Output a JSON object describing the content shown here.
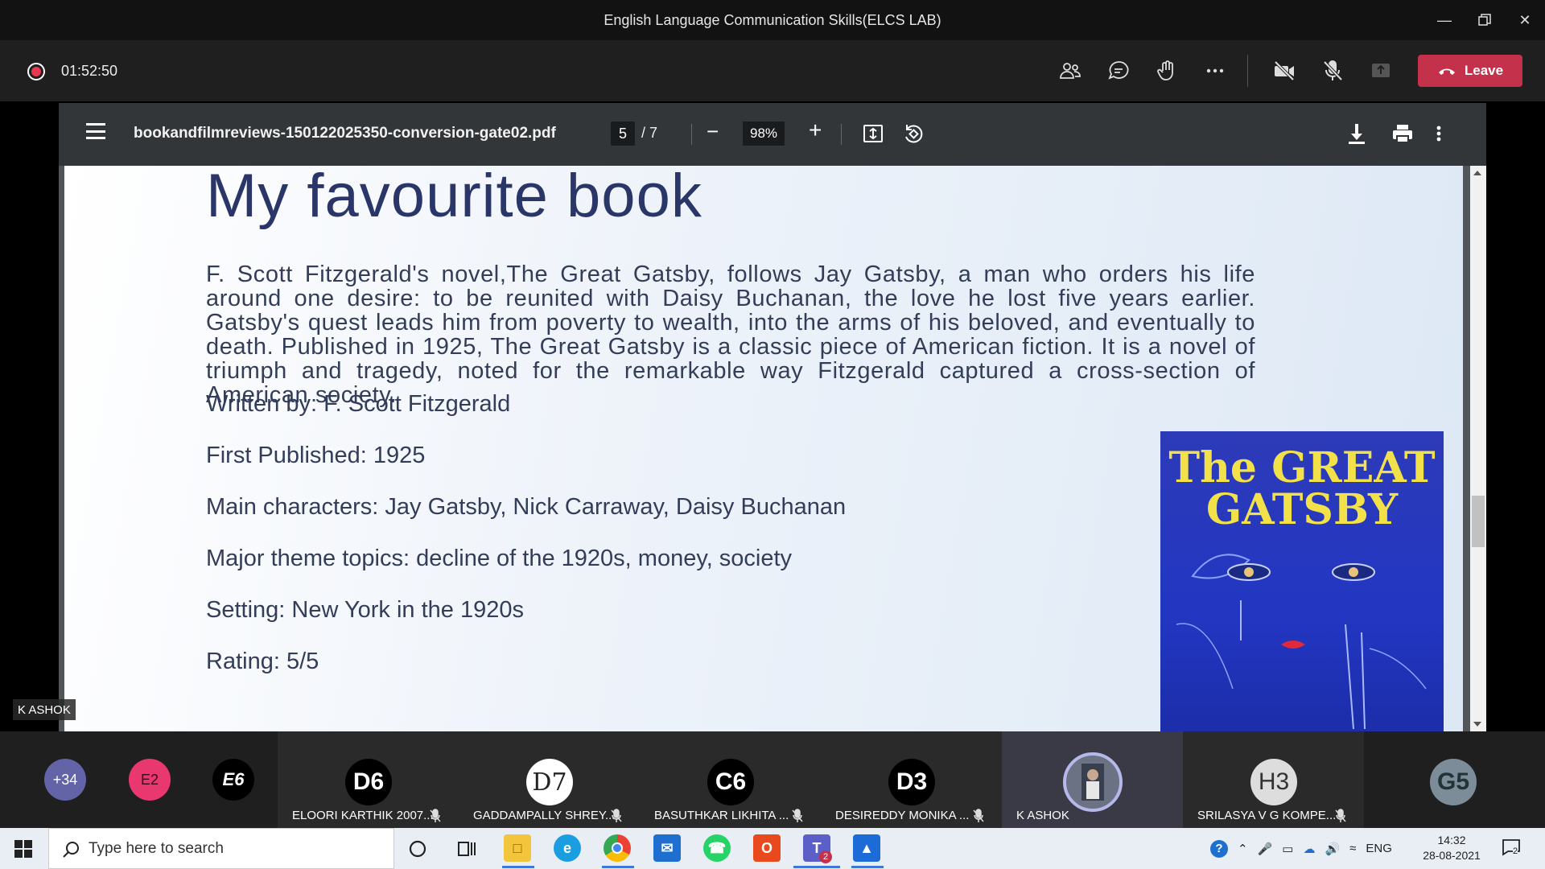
{
  "window": {
    "title": "English Language Communication Skills(ELCS LAB)"
  },
  "meeting": {
    "elapsed": "01:52:50",
    "leave_label": "Leave",
    "icons": [
      "people-icon",
      "chat-icon",
      "raise-hand-icon",
      "more-icon",
      "camera-off-icon",
      "mic-off-icon",
      "share-icon"
    ]
  },
  "pdf": {
    "filename": "bookandfilmreviews-150122025350-conversion-gate02.pdf",
    "current_page": "5",
    "page_total": "/ 7",
    "zoom": "98%"
  },
  "slide": {
    "title": "My favourite book",
    "synopsis": "F. Scott Fitzgerald's novel,The Great Gatsby, follows Jay Gatsby, a man who orders his life around one desire: to be reunited with Daisy Buchanan, the love he lost five years earlier. Gatsby's quest leads him from poverty to wealth, into the arms of his beloved, and eventually to death. Published in 1925, The Great Gatsby is a classic piece of American fiction. It is a novel of triumph and tragedy, noted for the remarkable way Fitzgerald captured a cross-section of American society.",
    "facts": [
      "Written by: F. Scott Fitzgerald",
      "First Published: 1925",
      "Main characters: Jay Gatsby, Nick Carraway, Daisy Buchanan",
      "Major theme topics: decline of the 1920s, money, society",
      "Setting: New York in the 1920s",
      "Rating: 5/5"
    ],
    "cover_title_line1": "The GREAT",
    "cover_title_line2": "GATSBY"
  },
  "presenter": "K ASHOK",
  "participants": {
    "overflow": "+34",
    "bubbles": [
      "E2",
      "E6"
    ],
    "tiles": [
      {
        "initials": "D6",
        "name": "ELOORI KARTHIK 2007..."
      },
      {
        "initials": "D7",
        "name": "GADDAMPALLY SHREY..."
      },
      {
        "initials": "C6",
        "name": "BASUTHKAR LIKHITA ..."
      },
      {
        "initials": "D3",
        "name": "DESIREDDY MONIKA ..."
      },
      {
        "initials": "",
        "name": "K ASHOK"
      },
      {
        "initials": "H3",
        "name": "SRILASYA V G KOMPE..."
      },
      {
        "initials": "G5",
        "name": ""
      }
    ]
  },
  "taskbar": {
    "search_placeholder": "Type here to search",
    "teams_badge": "2",
    "language": "ENG",
    "time": "14:32",
    "date": "28-08-2021",
    "notifications": "2"
  },
  "colors": {
    "leave": "#c4314b",
    "record": "#e8384f",
    "slide_text": "#333d58",
    "cover_bg": "#2236c2",
    "cover_title": "#f3e14a"
  }
}
